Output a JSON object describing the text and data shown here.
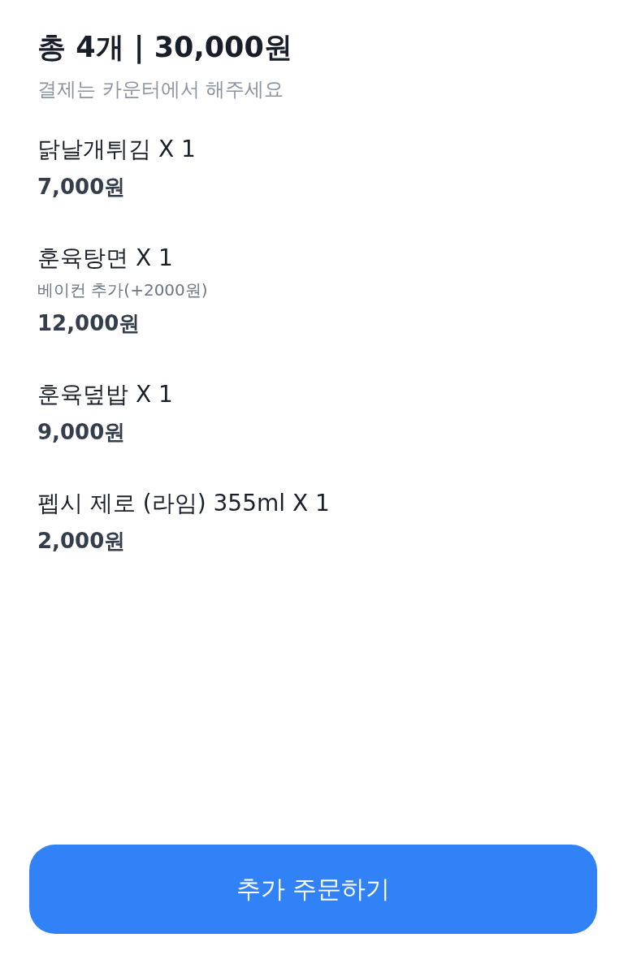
{
  "summary": {
    "title": "총 4개 | 30,000원",
    "subtitle": "결제는 카운터에서 해주세요"
  },
  "items": [
    {
      "name": "닭날개튀김 X 1",
      "price": "7,000원"
    },
    {
      "name": "훈육탕면 X 1",
      "option": "베이컨 추가(+2000원)",
      "price": "12,000원"
    },
    {
      "name": "훈육덮밥 X 1",
      "price": "9,000원"
    },
    {
      "name": "펩시 제로 (라임) 355ml X 1",
      "price": "2,000원"
    }
  ],
  "button": {
    "label": "추가 주문하기"
  }
}
